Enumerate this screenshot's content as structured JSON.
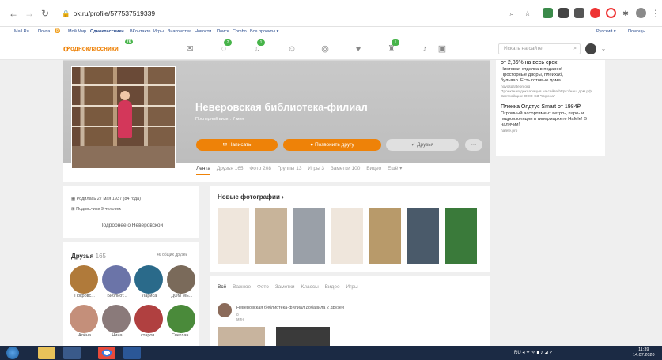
{
  "browser": {
    "url": "ok.ru/profile/577537519339",
    "bookmarks": [
      "Mail.Ru",
      "Почта",
      "Мой Мир",
      "Одноклассники",
      "ВКонтакте",
      "Игры",
      "Знакомства",
      "Новости",
      "Поиск",
      "Combo",
      "Все проекты ▾"
    ],
    "bookmark_right": [
      "Русский ▾",
      "Помощь"
    ],
    "mail_badge": "8"
  },
  "okbar": {
    "logo_text": "одноклассники",
    "logo_badge": "76",
    "search_placeholder": "Искать на сайте",
    "nav_badges": {
      "discussions": "2",
      "notifications": "1",
      "games": "1"
    }
  },
  "profile": {
    "name": "Неверовская библиотека-филиал",
    "last_visit": "Последний визит: 7 мин",
    "write_button": "Написать",
    "invite_button": "Позвонить другу",
    "friends_button": "✓ Друзья",
    "more_button": "···",
    "tabs": [
      "Лента",
      "Друзья 165",
      "Фото 208",
      "Группы 13",
      "Игры 3",
      "Заметки 100",
      "Видео",
      "Ещё ▾"
    ]
  },
  "ad": {
    "line1": "от 2,86% на весь срок!",
    "line2": "Чистовая отделка в подарок!",
    "line3": "Просторные дворы, плейхаб,",
    "line4": "бульвар. Есть готовые дома.",
    "src1": "novosgrateon.org",
    "src2": "Проектная декларация на сайте https://наш.дом.рф. Застройщик: ООО СЗ \"Укрона\"",
    "title2": "Пленка Оядтус Smart от 1984₽",
    "desc2": "Огромный ассортимент ветро-, паро- и гидроизоляции в гипермаркете Hafele! В наличии!",
    "src3": "hafele.pro"
  },
  "info": {
    "born": "Родилась 27 мая 1937 (84 года)",
    "subscribers": "Подписчики 9 человек",
    "more": "Подробнее о Неверовской"
  },
  "friends": {
    "title": "Друзья",
    "count": "165",
    "common": "46 общих друзей",
    "items": [
      {
        "name": "Покровс...",
        "color": "#b07a3a"
      },
      {
        "name": "Библиот...",
        "color": "#6b74a8"
      },
      {
        "name": "Лариса",
        "color": "#2a6a8a"
      },
      {
        "name": "ДОМ МЕ...",
        "color": "#7a6a5a"
      },
      {
        "name": "Алёна",
        "color": "#c48f7a"
      },
      {
        "name": "Нина",
        "color": "#8a7a7a"
      },
      {
        "name": "старов...",
        "color": "#b04040"
      },
      {
        "name": "Светлан...",
        "color": "#4a8a3a"
      }
    ]
  },
  "newphotos": {
    "title": "Новые фотографии ›",
    "thumbs": [
      "#efe6dc",
      "#c8b49a",
      "#9aa0a8",
      "#efe6dc",
      "#b89a6a",
      "#4a5a6a",
      "#3a7a3a"
    ]
  },
  "feed": {
    "tabs": [
      "Всё",
      "Важное",
      "Фото",
      "Заметки",
      "Классы",
      "Видео",
      "Игры"
    ],
    "post_text": "Неверовская библиотека-филиал добавила 2 друзей",
    "post_time": "8 мин"
  },
  "taskbar": {
    "lang": "RU",
    "time": "11:39",
    "date": "14.07.2020"
  }
}
